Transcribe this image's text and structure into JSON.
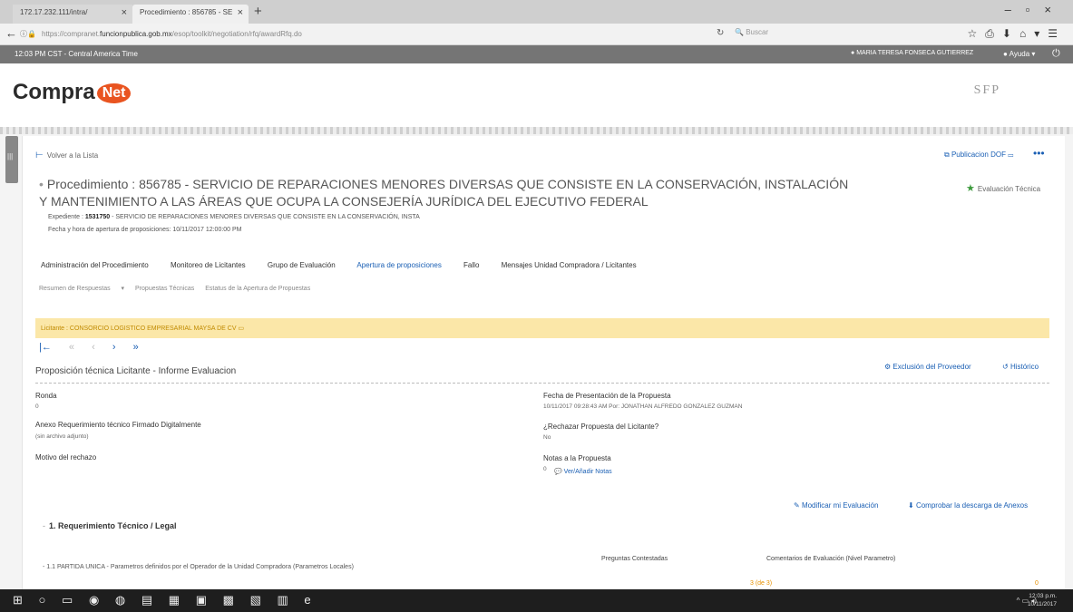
{
  "browser": {
    "tabs": [
      {
        "label": "172.17.232.111/intra/"
      },
      {
        "label": "Procedimiento : 856785 - SE"
      }
    ],
    "url_prefix": "https://compranet.",
    "url_domain": "funcionpublica.gob.mx",
    "url_path": "/esop/toolkit/negotiation/rfq/awardRfq.do",
    "search_placeholder": "Buscar"
  },
  "app_header": {
    "time": "12:03 PM CST - Central America Time",
    "user": "MARIA TERESA FONSECA GUTIERREZ",
    "help": "Ayuda"
  },
  "brand": {
    "logo_text": "Compra",
    "logo_badge": "Net",
    "agency": "SFP"
  },
  "procedure": {
    "return_link": "Volver a la Lista",
    "dof_link": "Publicacion DOF",
    "evaluation_link": "Evaluación Técnica",
    "title": "Procedimiento : 856785 - SERVICIO DE REPARACIONES MENORES DIVERSAS QUE CONSISTE EN LA CONSERVACIÓN, INSTALACIÓN Y MANTENIMIENTO A LAS ÁREAS QUE OCUPA LA CONSEJERÍA JURÍDICA DEL EJECUTIVO FEDERAL",
    "expediente_label": "Expediente :",
    "expediente_number": "1531750",
    "expediente_desc": "- SERVICIO DE REPARACIONES MENORES DIVERSAS QUE CONSISTE EN LA CONSERVACIÓN, INSTA",
    "apertura": "Fecha y hora de apertura de proposiciones: 10/11/2017 12:00:00 PM"
  },
  "tabs": [
    {
      "label": "Administración del Procedimiento"
    },
    {
      "label": "Monitoreo de Licitantes"
    },
    {
      "label": "Grupo de Evaluación"
    },
    {
      "label": "Apertura de proposiciones"
    },
    {
      "label": "Fallo"
    },
    {
      "label": "Mensajes Unidad Compradora / Licitantes"
    }
  ],
  "subtabs": [
    {
      "label": "Resumen de Respuestas"
    },
    {
      "label": "Propuestas Técnicas"
    },
    {
      "label": "Estatus de la Apertura de Propuestas"
    }
  ],
  "licitante": "Licitante : CONSORCIO LOGISTICO EMPRESARIAL MAYSA DE CV",
  "pager": {
    "first": "|←",
    "prev2": "«",
    "prev": "‹",
    "next": "›",
    "last": "»"
  },
  "section": {
    "title": "Proposición técnica Licitante - Informe Evaluacion",
    "exclusion_link": "Exclusión del Proveedor",
    "history_link": "Histórico"
  },
  "fields": {
    "ronda_label": "Ronda",
    "ronda_value": "0",
    "anexo_label": "Anexo Requerimiento técnico Firmado Digitalmente",
    "anexo_value": "(sin archivo adjunto)",
    "motivo_label": "Motivo del rechazo",
    "fecha_label": "Fecha de Presentación de la Propuesta",
    "fecha_value": "10/11/2017 09:28:43 AM Por: JONATHAN ALFREDO GONZALEZ GUZMAN",
    "rechazar_label": "¿Rechazar Propuesta del Licitante?",
    "rechazar_value": "No",
    "notas_label": "Notas a la Propuesta",
    "notas_count": "0",
    "notas_link": "Ver/Añadir Notas"
  },
  "actions": {
    "modificar": "Modificar mi Evaluación",
    "comprobar": "Comprobar la descarga de Anexos"
  },
  "requirement": {
    "title": "1. Requerimiento Técnico / Legal",
    "sub": "1.1 PARTIDA UNICA - Parametros definidos por el Operador de la Unidad Compradora (Parametros Locales)",
    "col_answered": "Preguntas Contestadas",
    "col_comments": "Comentarios de Evaluación (Nivel Parametro)",
    "answered_value": "3 (de 3)",
    "comments_value": "0"
  },
  "taskbar": {
    "time": "12:03 p.m.",
    "date": "10/11/2017"
  }
}
